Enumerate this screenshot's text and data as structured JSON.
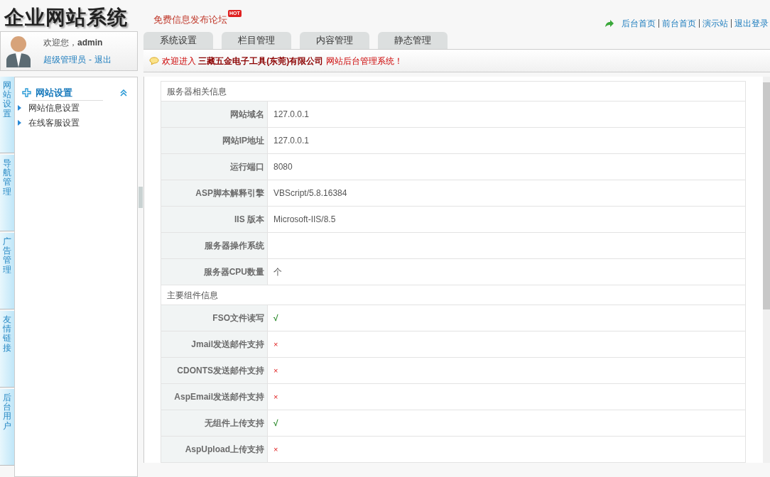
{
  "logo": "企业网站系统",
  "promo": {
    "label": "免费信息发布论坛",
    "badge": "HOT"
  },
  "top_links": [
    "后台首页",
    "前台首页",
    "演示站",
    "退出登录"
  ],
  "user": {
    "greeting": "欢迎您，",
    "name": "admin",
    "role": "超级管理员",
    "separator": "-",
    "logout": "退出"
  },
  "tabs": [
    "系统设置",
    "栏目管理",
    "内容管理",
    "静态管理"
  ],
  "welcome": "欢迎进入 **三藏五金电子工具(东莞)有限公司** 网站后台管理系统！",
  "side_tabs": [
    "网站设置",
    "导航管理",
    "广告管理",
    "友情链接",
    "后台用户"
  ],
  "menu": {
    "title": "网站设置",
    "expanded": true,
    "items": [
      "网站信息设置",
      "在线客服设置"
    ]
  },
  "sections": [
    {
      "title": "服务器相关信息",
      "rows": [
        {
          "label": "网站域名",
          "kind": "text",
          "value": "127.0.0.1"
        },
        {
          "label": "网站IP地址",
          "kind": "text",
          "value": "127.0.0.1"
        },
        {
          "label": "运行端口",
          "kind": "text",
          "value": "8080"
        },
        {
          "label": "ASP脚本解释引擎",
          "kind": "text",
          "value": "VBScript/5.8.16384"
        },
        {
          "label": "IIS 版本",
          "kind": "text",
          "value": "Microsoft-IIS/8.5"
        },
        {
          "label": "服务器操作系统",
          "kind": "text"
        },
        {
          "label": "服务器CPU数量",
          "kind": "text",
          "value": "个"
        }
      ]
    },
    {
      "title": "主要组件信息",
      "rows": [
        {
          "label": "FSO文件读写",
          "kind": "yes",
          "value": "√"
        },
        {
          "label": "Jmail发送邮件支持",
          "kind": "no",
          "value": "×"
        },
        {
          "label": "CDONTS发送邮件支持",
          "kind": "no",
          "value": "×"
        },
        {
          "label": "AspEmail发送邮件支持",
          "kind": "no",
          "value": "×"
        },
        {
          "label": "无组件上传支持",
          "kind": "yes",
          "value": "√"
        },
        {
          "label": "AspUpload上传支持",
          "kind": "no",
          "value": "×"
        }
      ]
    }
  ]
}
